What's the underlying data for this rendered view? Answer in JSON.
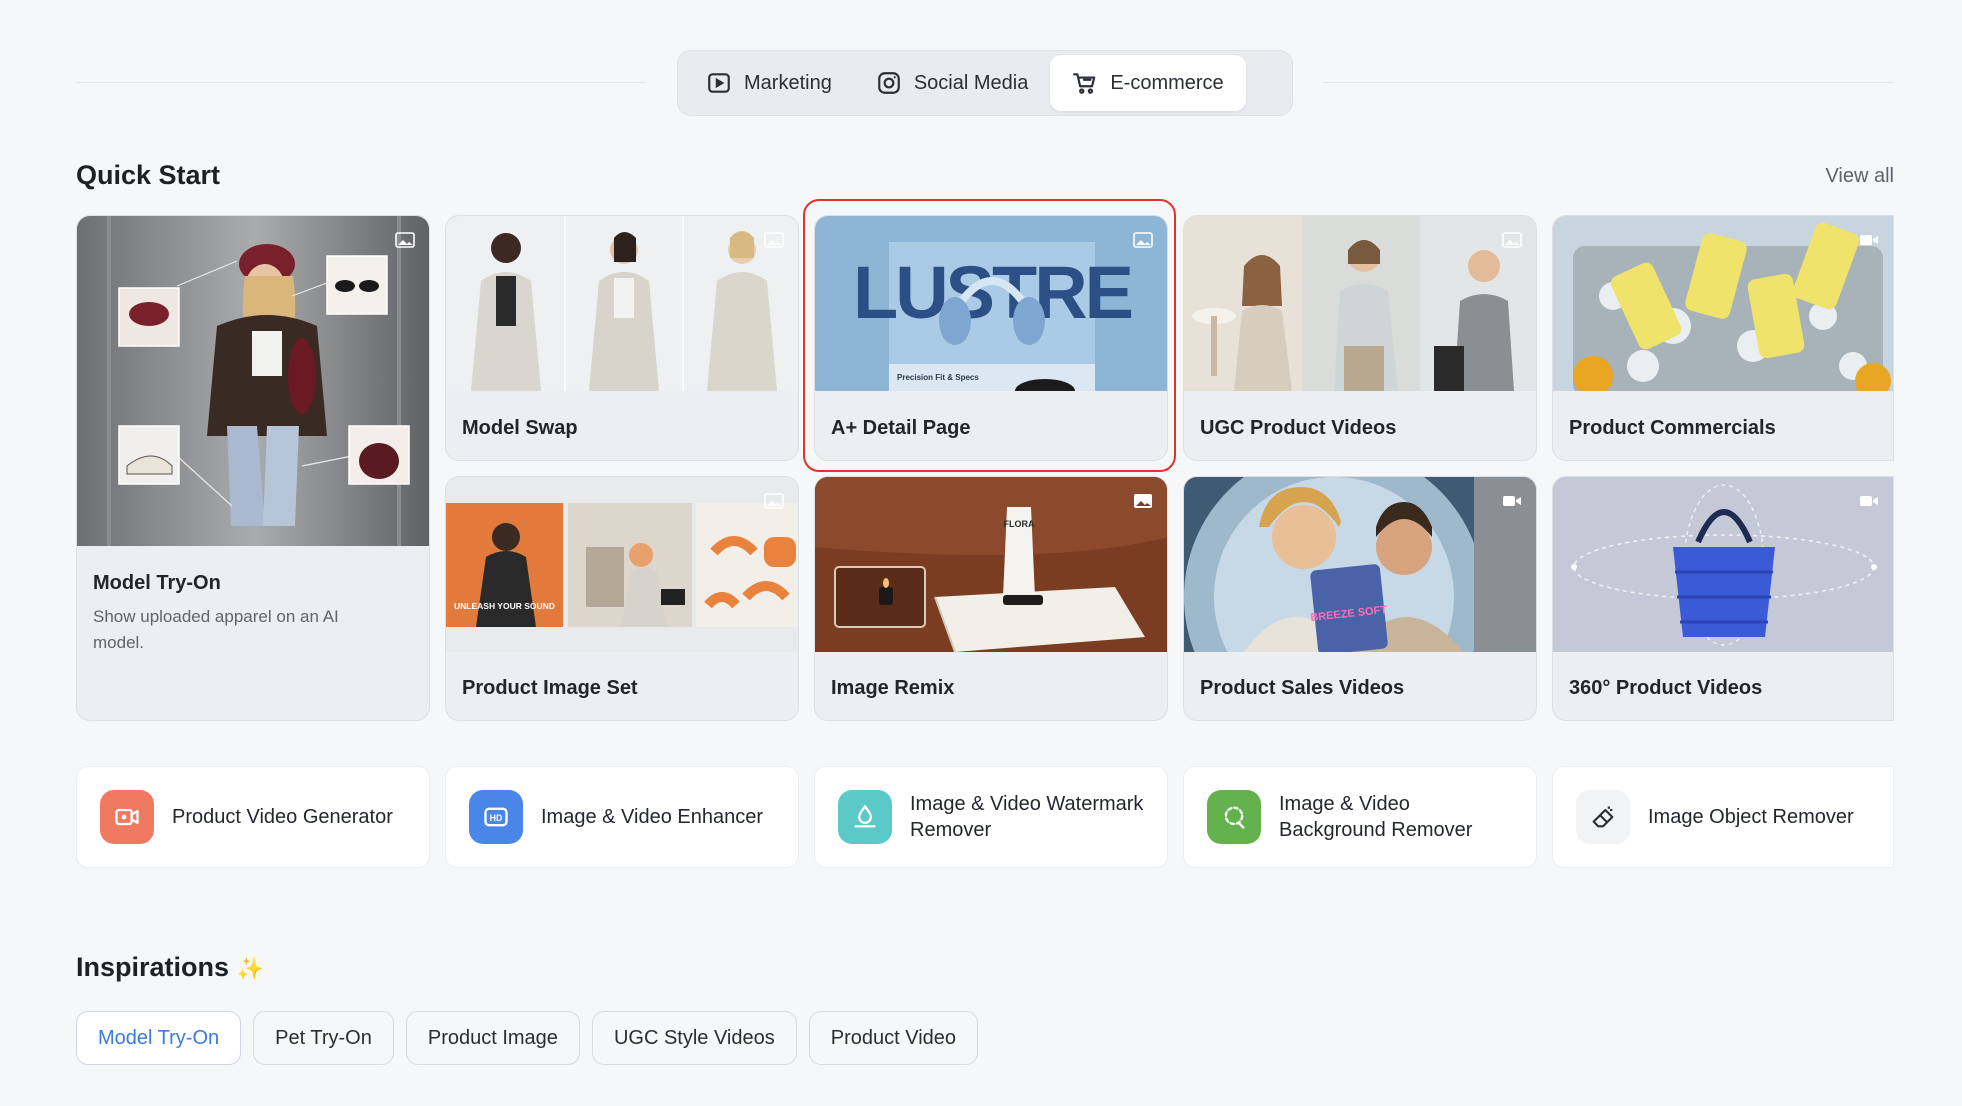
{
  "tabs": [
    {
      "label": "Marketing",
      "icon": "play-square-icon"
    },
    {
      "label": "Social Media",
      "icon": "instagram-icon"
    },
    {
      "label": "E-commerce",
      "icon": "cart-icon"
    }
  ],
  "active_tab": "E-commerce",
  "quick_start": {
    "title": "Quick Start",
    "view_all": "View all",
    "featured": {
      "label": "Model Try-On",
      "description": "Show uploaded apparel on an AI model."
    },
    "cards": [
      {
        "label": "Model Swap",
        "kind": "image-icon"
      },
      {
        "label": "A+ Detail Page",
        "kind": "image-icon",
        "selected": true
      },
      {
        "label": "UGC Product Videos",
        "kind": "image-icon"
      },
      {
        "label": "Product Commercials",
        "kind": "video-icon"
      },
      {
        "label": "Product Image Set",
        "kind": "image-icon"
      },
      {
        "label": "Image Remix",
        "kind": "image-icon"
      },
      {
        "label": "Product Sales Videos",
        "kind": "video-icon"
      },
      {
        "label": "360° Product Videos",
        "kind": "video-icon"
      }
    ],
    "thumb_text": {
      "lustre": "LUSTRE",
      "lustre_sub": "Precision Fit & Specs",
      "unleash": "UNLEASH YOUR SOUND",
      "flora": "FLORA",
      "breeze": "BREEZE SOFT"
    }
  },
  "tools": [
    {
      "label": "Product Video Generator",
      "icon": "video-camera-icon",
      "color": "#ef7a61"
    },
    {
      "label": "Image & Video Enhancer",
      "icon": "hd-icon",
      "color": "#4a86e8"
    },
    {
      "label": "Image & Video Watermark Remover",
      "icon": "watermark-icon",
      "color": "#5cc9c9"
    },
    {
      "label": "Image & Video Background Remover",
      "icon": "background-remove-icon",
      "color": "#64b24e"
    },
    {
      "label": "Image Object Remover",
      "icon": "eraser-icon",
      "color": "#f2f3f5"
    }
  ],
  "inspirations": {
    "title": "Inspirations",
    "sparkle": "✨",
    "chips": [
      "Model Try-On",
      "Pet Try-On",
      "Product Image",
      "UGC Style Videos",
      "Product Video"
    ],
    "active_chip": "Model Try-On"
  }
}
